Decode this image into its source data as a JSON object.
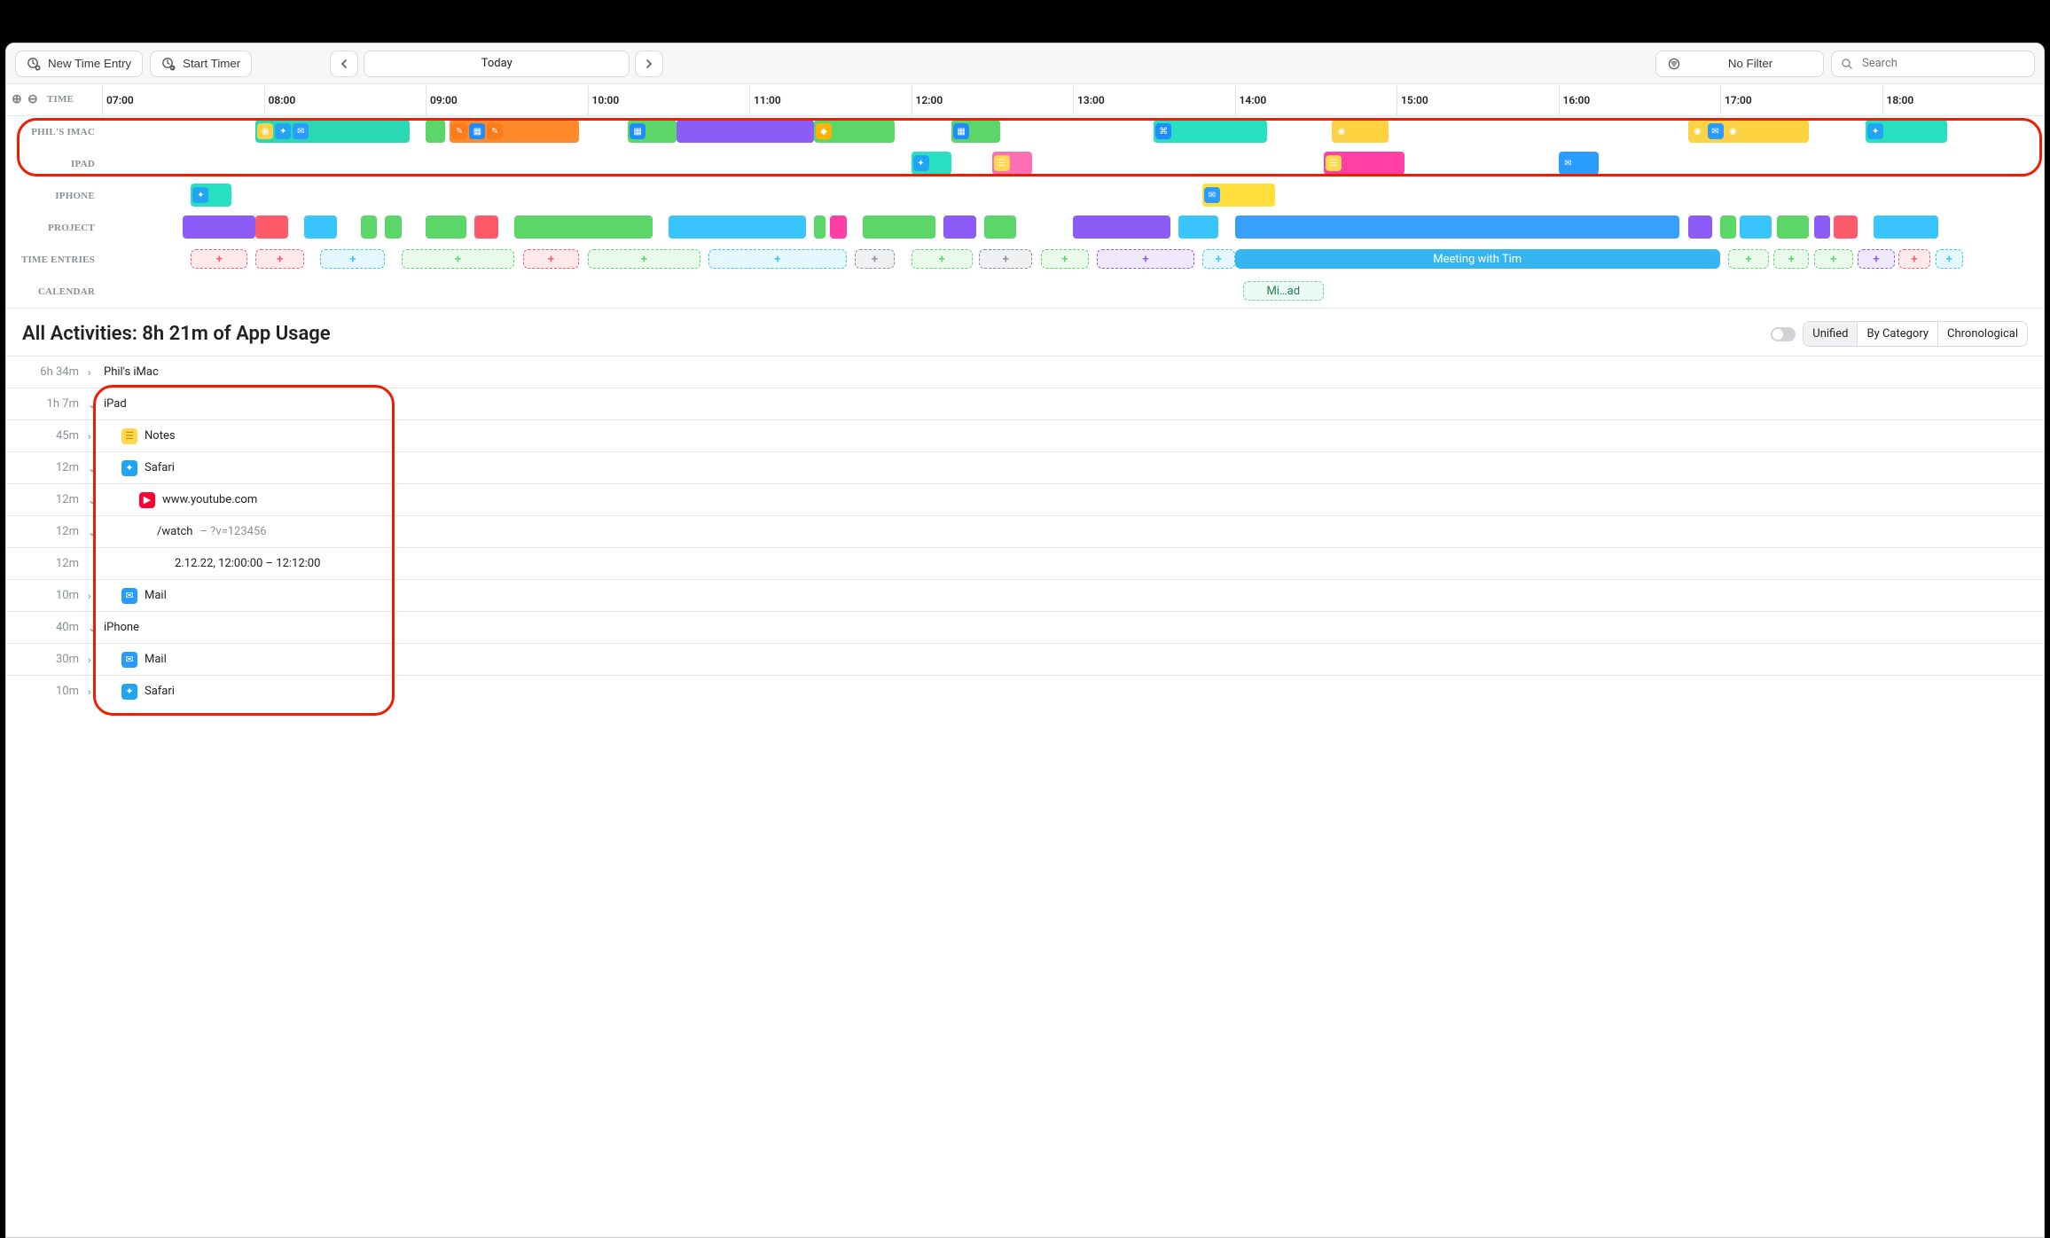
{
  "toolbar": {
    "newEntry": "New Time Entry",
    "startTimer": "Start Timer",
    "today": "Today",
    "noFilter": "No Filter",
    "searchPlaceholder": "Search"
  },
  "timeline": {
    "startHour": 7,
    "endHour": 18,
    "timeLabel": "TIME",
    "hours": [
      "07:00",
      "08:00",
      "09:00",
      "10:00",
      "11:00",
      "12:00",
      "13:00",
      "14:00",
      "15:00",
      "16:00",
      "17:00",
      "18:00"
    ],
    "rows": [
      "PHIL'S IMAC",
      "IPAD",
      "IPHONE",
      "PROJECT",
      "TIME ENTRIES",
      "CALENDAR"
    ],
    "meetingBlock": {
      "label": "Meeting with Tim",
      "start": 14.0,
      "end": 17.0,
      "color": "#36b6f0"
    },
    "calendarChip": {
      "label": "Mi…ad",
      "start": 14.05,
      "end": 14.55,
      "color": "#6ad4a0"
    },
    "imac": [
      {
        "start": 7.95,
        "end": 8.9,
        "type": "iconrow",
        "bg": "#2ad9b2",
        "icons": [
          {
            "name": "chrome-icon",
            "bg": "#f9d24a"
          },
          {
            "name": "safari-icon",
            "bg": "#20a4f3"
          },
          {
            "name": "mail-icon",
            "bg": "#2b9cff"
          }
        ]
      },
      {
        "start": 9.0,
        "end": 9.12,
        "type": "block",
        "bg": "#5bd769"
      },
      {
        "start": 9.15,
        "end": 9.95,
        "type": "iconrow",
        "bg": "#ff8a2b",
        "icons": [
          {
            "name": "pages-icon",
            "bg": "#ff7a18"
          },
          {
            "name": "keynote-icon",
            "bg": "#1f8cff"
          },
          {
            "name": "pages-icon",
            "bg": "#ff7a18"
          }
        ]
      },
      {
        "start": 10.25,
        "end": 10.55,
        "type": "iconrow",
        "bg": "#5bd769",
        "icons": [
          {
            "name": "keynote-icon",
            "bg": "#1f8cff"
          }
        ]
      },
      {
        "start": 10.55,
        "end": 11.4,
        "type": "block",
        "bg": "#8b5cf6"
      },
      {
        "start": 11.4,
        "end": 11.9,
        "type": "iconrow",
        "bg": "#5bd769",
        "icons": [
          {
            "name": "sketch-icon",
            "bg": "#ffb300"
          }
        ]
      },
      {
        "start": 12.25,
        "end": 12.55,
        "type": "iconrow",
        "bg": "#5bd769",
        "icons": [
          {
            "name": "keynote-icon",
            "bg": "#1f8cff"
          }
        ]
      },
      {
        "start": 13.5,
        "end": 14.2,
        "type": "iconrow",
        "bg": "#27e0bf",
        "icons": [
          {
            "name": "xcode-icon",
            "bg": "#1f8cff"
          }
        ]
      },
      {
        "start": 14.6,
        "end": 14.95,
        "type": "iconrow",
        "bg": "#ffd23f",
        "icons": [
          {
            "name": "chrome-icon",
            "bg": "#f9d24a"
          }
        ]
      },
      {
        "start": 16.8,
        "end": 17.55,
        "type": "iconrow",
        "bg": "#ffd23f",
        "icons": [
          {
            "name": "chrome-icon",
            "bg": "#f9d24a"
          },
          {
            "name": "mail-icon",
            "bg": "#2b9cff"
          },
          {
            "name": "chrome-icon",
            "bg": "#f9d24a"
          }
        ]
      },
      {
        "start": 17.9,
        "end": 18.4,
        "type": "iconrow",
        "bg": "#27e0bf",
        "icons": [
          {
            "name": "safari-icon",
            "bg": "#20a4f3"
          }
        ]
      }
    ],
    "ipad": [
      {
        "start": 12.0,
        "end": 12.25,
        "type": "iconrow",
        "bg": "#27e0bf",
        "icons": [
          {
            "name": "safari-icon",
            "bg": "#20a4f3"
          }
        ]
      },
      {
        "start": 12.5,
        "end": 12.75,
        "type": "iconrow",
        "bg": "#ff6fb5",
        "icons": [
          {
            "name": "notes-icon",
            "bg": "#ffd84d"
          }
        ]
      },
      {
        "start": 14.55,
        "end": 15.05,
        "type": "iconrow",
        "bg": "#ff3fa3",
        "icons": [
          {
            "name": "notes-icon",
            "bg": "#ffd84d"
          }
        ]
      },
      {
        "start": 16.0,
        "end": 16.25,
        "type": "iconrow",
        "bg": "#2b9cff",
        "icons": [
          {
            "name": "mail-icon",
            "bg": "#2b9cff"
          }
        ]
      }
    ],
    "iphone": [
      {
        "start": 7.55,
        "end": 7.8,
        "type": "iconrow",
        "bg": "#27e0bf",
        "icons": [
          {
            "name": "safari-icon",
            "bg": "#20a4f3"
          }
        ]
      },
      {
        "start": 13.8,
        "end": 14.25,
        "type": "iconrow",
        "bg": "#ffde3d",
        "icons": [
          {
            "name": "mail-icon",
            "bg": "#2b9cff"
          }
        ]
      }
    ],
    "project": [
      {
        "start": 7.5,
        "end": 7.95,
        "bg": "#8b5cf6"
      },
      {
        "start": 7.95,
        "end": 8.15,
        "bg": "#ff5a6a"
      },
      {
        "start": 8.25,
        "end": 8.45,
        "bg": "#39c6ff"
      },
      {
        "start": 8.6,
        "end": 8.7,
        "bg": "#5bd769"
      },
      {
        "start": 8.75,
        "end": 8.85,
        "bg": "#5bd769"
      },
      {
        "start": 9.0,
        "end": 9.25,
        "bg": "#5bd769"
      },
      {
        "start": 9.3,
        "end": 9.45,
        "bg": "#ff5a6a"
      },
      {
        "start": 9.55,
        "end": 10.4,
        "bg": "#5bd769"
      },
      {
        "start": 10.5,
        "end": 11.35,
        "bg": "#39c6ff"
      },
      {
        "start": 11.4,
        "end": 11.47,
        "bg": "#5bd769"
      },
      {
        "start": 11.5,
        "end": 11.6,
        "bg": "#ff3fa3"
      },
      {
        "start": 11.7,
        "end": 12.15,
        "bg": "#5bd769"
      },
      {
        "start": 12.2,
        "end": 12.4,
        "bg": "#8b5cf6"
      },
      {
        "start": 12.45,
        "end": 12.65,
        "bg": "#5bd769"
      },
      {
        "start": 13.0,
        "end": 13.6,
        "bg": "#8b5cf6"
      },
      {
        "start": 13.65,
        "end": 13.9,
        "bg": "#39c6ff"
      },
      {
        "start": 14.0,
        "end": 16.75,
        "bg": "#3aa0ff"
      },
      {
        "start": 16.8,
        "end": 16.95,
        "bg": "#8b5cf6"
      },
      {
        "start": 17.0,
        "end": 17.1,
        "bg": "#5bd769"
      },
      {
        "start": 17.12,
        "end": 17.32,
        "bg": "#39c6ff"
      },
      {
        "start": 17.35,
        "end": 17.55,
        "bg": "#5bd769"
      },
      {
        "start": 17.58,
        "end": 17.68,
        "bg": "#8b5cf6"
      },
      {
        "start": 17.7,
        "end": 17.85,
        "bg": "#ff5a6a"
      },
      {
        "start": 17.95,
        "end": 18.35,
        "bg": "#39c6ff"
      }
    ],
    "timeEntries": [
      {
        "start": 7.55,
        "end": 7.9,
        "color": "#ff5a6a",
        "dashed": true,
        "label": "+"
      },
      {
        "start": 7.95,
        "end": 8.25,
        "color": "#ff5a6a",
        "dashed": true,
        "label": "+"
      },
      {
        "start": 8.35,
        "end": 8.75,
        "color": "#39c6ff",
        "dashed": true,
        "label": "+"
      },
      {
        "start": 8.85,
        "end": 9.55,
        "color": "#5bd769",
        "dashed": true,
        "label": "+"
      },
      {
        "start": 9.6,
        "end": 9.95,
        "color": "#ff5a6a",
        "dashed": true,
        "label": "+"
      },
      {
        "start": 10.0,
        "end": 10.7,
        "color": "#5bd769",
        "dashed": true,
        "label": "+"
      },
      {
        "start": 10.75,
        "end": 11.6,
        "color": "#39c6ff",
        "dashed": true,
        "label": "+"
      },
      {
        "start": 11.65,
        "end": 11.9,
        "color": "#8a8f98",
        "dashed": true,
        "label": "+"
      },
      {
        "start": 12.0,
        "end": 12.38,
        "color": "#5bd769",
        "dashed": true,
        "label": "+"
      },
      {
        "start": 12.42,
        "end": 12.75,
        "color": "#8a8f98",
        "dashed": true,
        "label": "+"
      },
      {
        "start": 12.8,
        "end": 13.1,
        "color": "#5bd769",
        "dashed": true,
        "label": "+"
      },
      {
        "start": 13.15,
        "end": 13.75,
        "color": "#8b5cf6",
        "dashed": true,
        "label": "+"
      },
      {
        "start": 13.8,
        "end": 14.0,
        "color": "#39c6ff",
        "dashed": true,
        "label": "+"
      },
      {
        "start": 17.05,
        "end": 17.3,
        "color": "#5bd769",
        "dashed": true,
        "label": "+"
      },
      {
        "start": 17.33,
        "end": 17.55,
        "color": "#5bd769",
        "dashed": true,
        "label": "+"
      },
      {
        "start": 17.58,
        "end": 17.82,
        "color": "#5bd769",
        "dashed": true,
        "label": "+"
      },
      {
        "start": 17.85,
        "end": 18.08,
        "color": "#8b5cf6",
        "dashed": true,
        "label": "+"
      },
      {
        "start": 18.1,
        "end": 18.3,
        "color": "#ff5a6a",
        "dashed": true,
        "label": "+"
      },
      {
        "start": 18.33,
        "end": 18.5,
        "color": "#39c6ff",
        "dashed": true,
        "label": "+"
      }
    ]
  },
  "activities": {
    "heading": "All Activities: 8h 21m of App Usage",
    "viewTabs": [
      "Unified",
      "By Category",
      "Chronological"
    ],
    "rows": [
      {
        "dur": "6h 34m",
        "exp": "›",
        "indent": 0,
        "icon": null,
        "label": "Phil's iMac",
        "muted": false
      },
      {
        "dur": "1h 7m",
        "exp": "⌄",
        "indent": 0,
        "icon": null,
        "label": "iPad",
        "muted": false
      },
      {
        "dur": "45m",
        "exp": "›",
        "indent": 1,
        "icon": {
          "name": "notes-icon",
          "bg": "#ffd84d",
          "fg": "#c78b00"
        },
        "label": "Notes"
      },
      {
        "dur": "12m",
        "exp": "⌄",
        "indent": 1,
        "icon": {
          "name": "safari-icon",
          "bg": "#20a4f3"
        },
        "label": "Safari"
      },
      {
        "dur": "12m",
        "exp": "⌄",
        "indent": 2,
        "icon": {
          "name": "youtube-icon",
          "bg": "#ff0033"
        },
        "label": "www.youtube.com"
      },
      {
        "dur": "12m",
        "exp": "⌄",
        "indent": 3,
        "icon": null,
        "label": "/watch",
        "suffix": " – ?v=123456"
      },
      {
        "dur": "12m",
        "exp": "",
        "indent": 4,
        "icon": null,
        "label": "2.12.22, 12:00:00 – 12:12:00"
      },
      {
        "dur": "10m",
        "exp": "›",
        "indent": 1,
        "icon": {
          "name": "mail-icon",
          "bg": "#2b9cff"
        },
        "label": "Mail"
      },
      {
        "dur": "40m",
        "exp": "⌄",
        "indent": 0,
        "icon": null,
        "label": "iPhone",
        "muted": false
      },
      {
        "dur": "30m",
        "exp": "›",
        "indent": 1,
        "icon": {
          "name": "mail-icon",
          "bg": "#2b9cff"
        },
        "label": "Mail"
      },
      {
        "dur": "10m",
        "exp": "›",
        "indent": 1,
        "icon": {
          "name": "safari-icon",
          "bg": "#20a4f3"
        },
        "label": "Safari"
      }
    ]
  },
  "icons": {
    "chrome-icon": "◉",
    "safari-icon": "✦",
    "mail-icon": "✉",
    "notes-icon": "☰",
    "pages-icon": "✎",
    "keynote-icon": "▦",
    "sketch-icon": "◆",
    "xcode-icon": "⌘",
    "youtube-icon": "▶"
  }
}
